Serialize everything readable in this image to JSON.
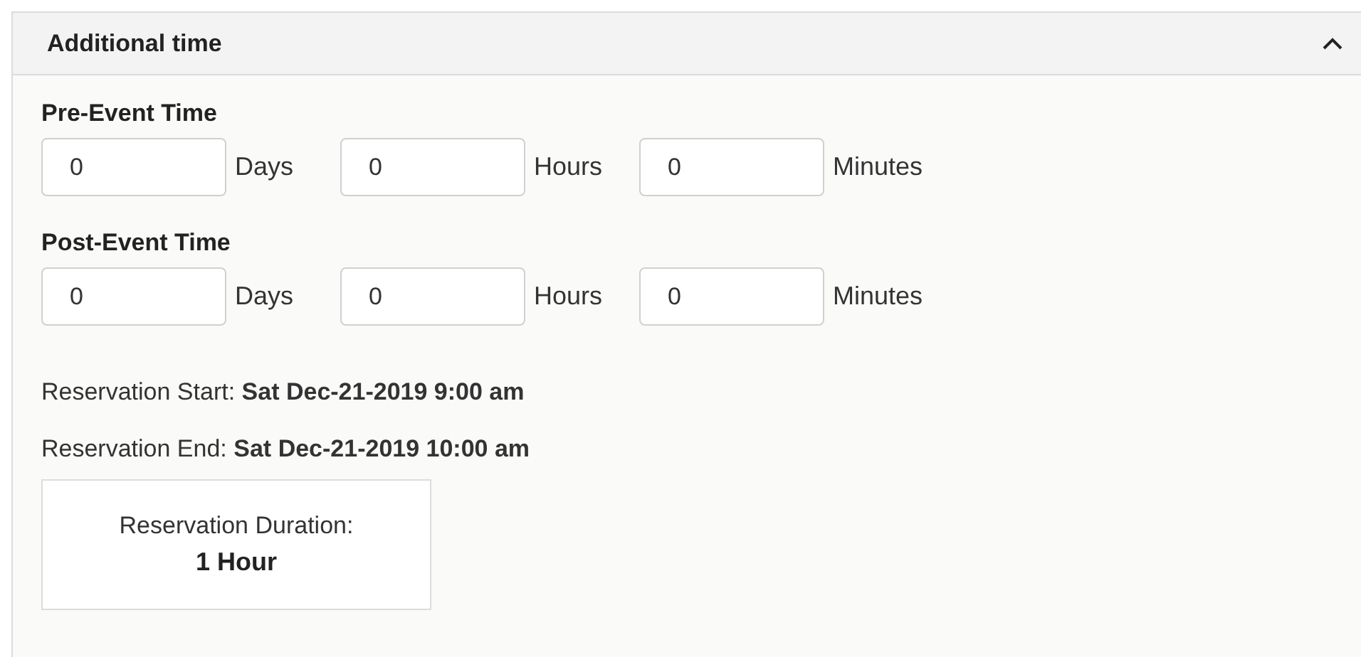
{
  "panel": {
    "title": "Additional time",
    "expanded": true
  },
  "sections": [
    {
      "title": "Pre-Event Time",
      "fields": [
        {
          "value": "0",
          "unit": "Days"
        },
        {
          "value": "0",
          "unit": "Hours"
        },
        {
          "value": "0",
          "unit": "Minutes"
        }
      ]
    },
    {
      "title": "Post-Event Time",
      "fields": [
        {
          "value": "0",
          "unit": "Days"
        },
        {
          "value": "0",
          "unit": "Hours"
        },
        {
          "value": "0",
          "unit": "Minutes"
        }
      ]
    }
  ],
  "reservation_lines": [
    "Reservation Start: **Sat Dec-21-2019 9:00 am**",
    "Reservation End: **Sat Dec-21-2019 10:00 am**"
  ],
  "duration": {
    "label": "Reservation Duration:",
    "value": "1 Hour"
  }
}
